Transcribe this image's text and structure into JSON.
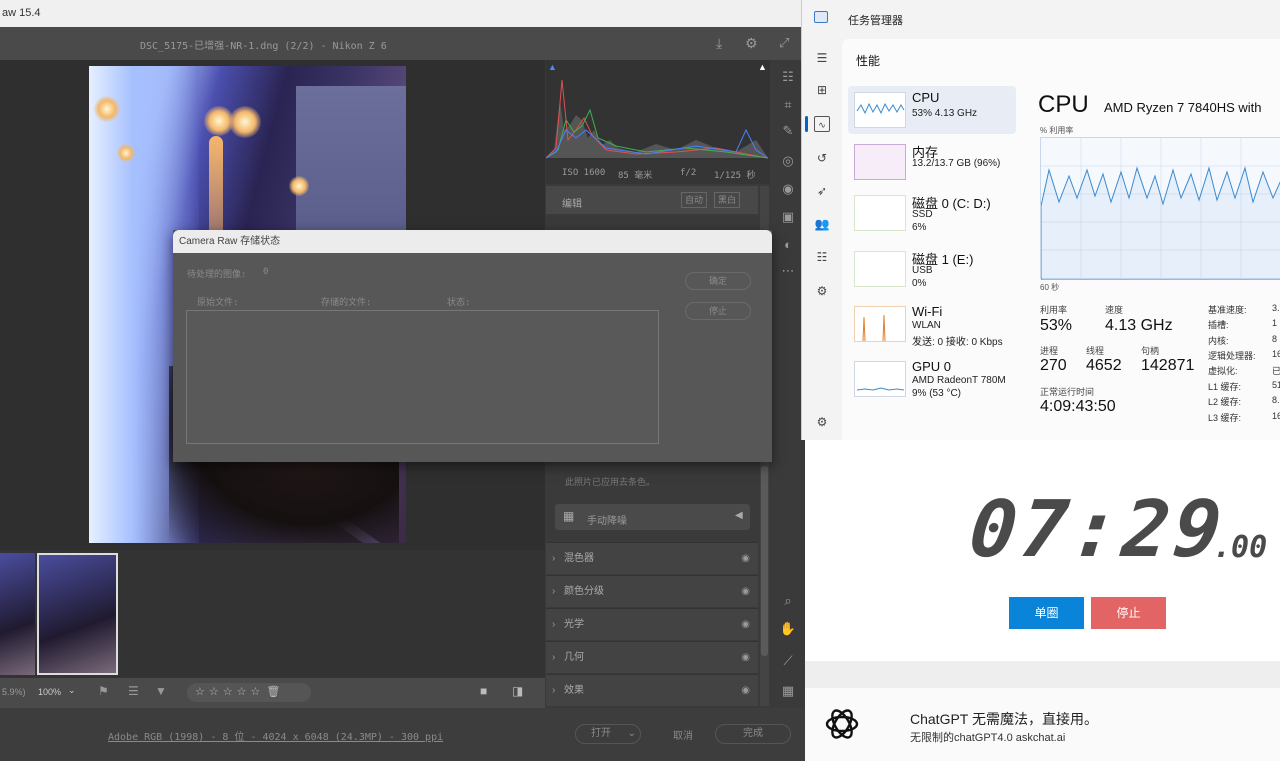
{
  "camera_raw": {
    "window_title": "aw 15.4",
    "file_title": "DSC_5175-已增强-NR-1.dng (2/2) - Nikon Z 6",
    "exif": {
      "iso": "ISO 1600",
      "focal": "85 毫米",
      "aperture": "f/2",
      "shutter": "1/125 秒"
    },
    "edit_label": "编辑",
    "auto_label": "自动",
    "bw_label": "黑白",
    "defringe_note": "此照片已应用去条色。",
    "manual_nr_label": "手动降噪",
    "sections": [
      "混色器",
      "颜色分级",
      "光学",
      "几何",
      "效果"
    ],
    "zoom_left": "5.9%)",
    "zoom_value": "100%",
    "status_link": "Adobe RGB (1998) - 8 位 - 4024 x 6048 (24.3MP) - 300 ppi",
    "open_label": "打开",
    "cancel_label": "取消",
    "done_label": "完成"
  },
  "save_dialog": {
    "title": "Camera Raw 存储状态",
    "pending_label": "待处理的图像:",
    "pending_value": "0",
    "col_source": "原始文件:",
    "col_saved": "存储的文件:",
    "col_status": "状态:",
    "ok_label": "确定",
    "stop_label": "停止"
  },
  "task_manager": {
    "title": "任务管理器",
    "section": "性能",
    "resources": [
      {
        "name": "CPU",
        "line1": "53% 4.13 GHz",
        "line2": ""
      },
      {
        "name": "内存",
        "line1": "13.2/13.7 GB (96%)",
        "line2": ""
      },
      {
        "name": "磁盘 0 (C: D:)",
        "line1": "SSD",
        "line2": "6%"
      },
      {
        "name": "磁盘 1 (E:)",
        "line1": "USB",
        "line2": "0%"
      },
      {
        "name": "Wi-Fi",
        "line1": "WLAN",
        "line2": "发送: 0 接收: 0 Kbps"
      },
      {
        "name": "GPU 0",
        "line1": "AMD RadeonT 780M",
        "line2": "9% (53 °C)"
      }
    ],
    "cpu_title": "CPU",
    "cpu_model": "AMD Ryzen 7 7840HS with",
    "util_label": "% 利用率",
    "seconds_label": "60 秒",
    "stats": {
      "util_label": "利用率",
      "util_value": "53%",
      "speed_label": "速度",
      "speed_value": "4.13 GHz",
      "proc_label": "进程",
      "proc_value": "270",
      "thread_label": "线程",
      "thread_value": "4652",
      "handle_label": "句柄",
      "handle_value": "142871",
      "uptime_label": "正常运行时间",
      "uptime_value": "4:09:43:50"
    },
    "details": [
      {
        "k": "基准速度:",
        "v": "3."
      },
      {
        "k": "插槽:",
        "v": "1"
      },
      {
        "k": "内核:",
        "v": "8"
      },
      {
        "k": "逻辑处理器:",
        "v": "16"
      },
      {
        "k": "虚拟化:",
        "v": "已"
      },
      {
        "k": "L1 缓存:",
        "v": "51"
      },
      {
        "k": "L2 缓存:",
        "v": "8."
      },
      {
        "k": "L3 缓存:",
        "v": "16"
      }
    ]
  },
  "timer": {
    "time": "07:29",
    "fraction": ".00",
    "lap_label": "单圈",
    "stop_label": "停止",
    "lap_color": "#0a84d8",
    "stop_color": "#e36464"
  },
  "ad": {
    "title": "ChatGPT 无需魔法，直接用。",
    "subtitle": "无限制的chatGPT4.0 askchat.ai"
  }
}
